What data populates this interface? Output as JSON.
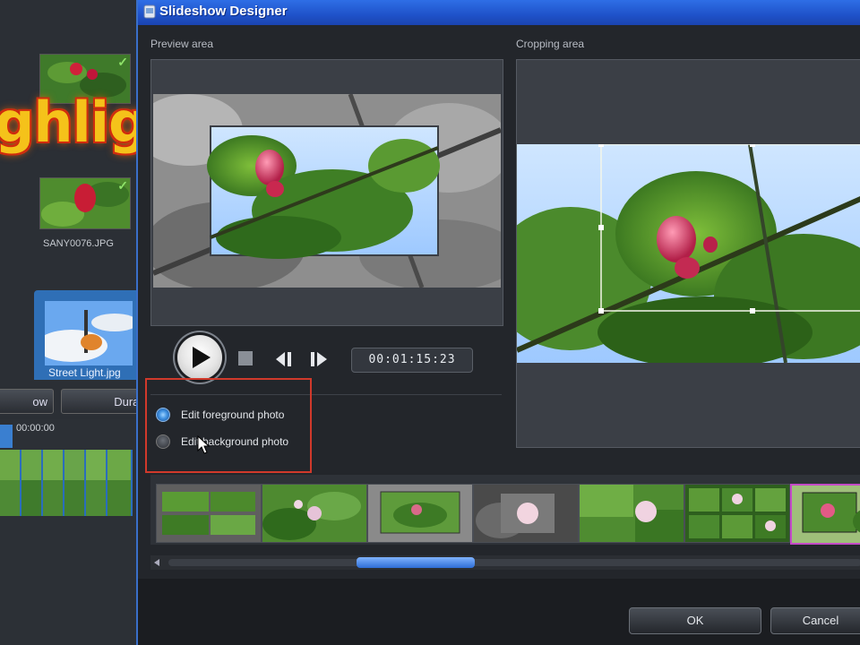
{
  "overlay": {
    "highlight_text": "ghlight"
  },
  "host": {
    "filename": "SANY0076.JPG",
    "selected_label": "Street Light.jpg",
    "button_left": "ow",
    "button_right": "Durat",
    "timeline_time": "00:00:00"
  },
  "dialog": {
    "title": "Slideshow Designer",
    "preview_label": "Preview area",
    "crop_label": "Cropping area",
    "timecode": "00:01:15:23",
    "options": [
      {
        "label": "Edit foreground photo",
        "selected": true
      },
      {
        "label": "Edit background photo",
        "selected": false
      }
    ],
    "ok_label": "OK",
    "cancel_label": "Cancel",
    "template_count": 7,
    "selected_template": 7,
    "scroll_position": 0.3
  },
  "colors": {
    "title_bar": "#2e6ee6",
    "accent_selection": "#2f6fb6",
    "options_highlight_box": "#d0392b",
    "selected_template_border": "#c44ac7"
  },
  "icons": [
    "play-icon",
    "stop-icon",
    "prev-frame-icon",
    "next-frame-icon",
    "app-icon",
    "check-icon",
    "mouse-cursor-icon"
  ]
}
